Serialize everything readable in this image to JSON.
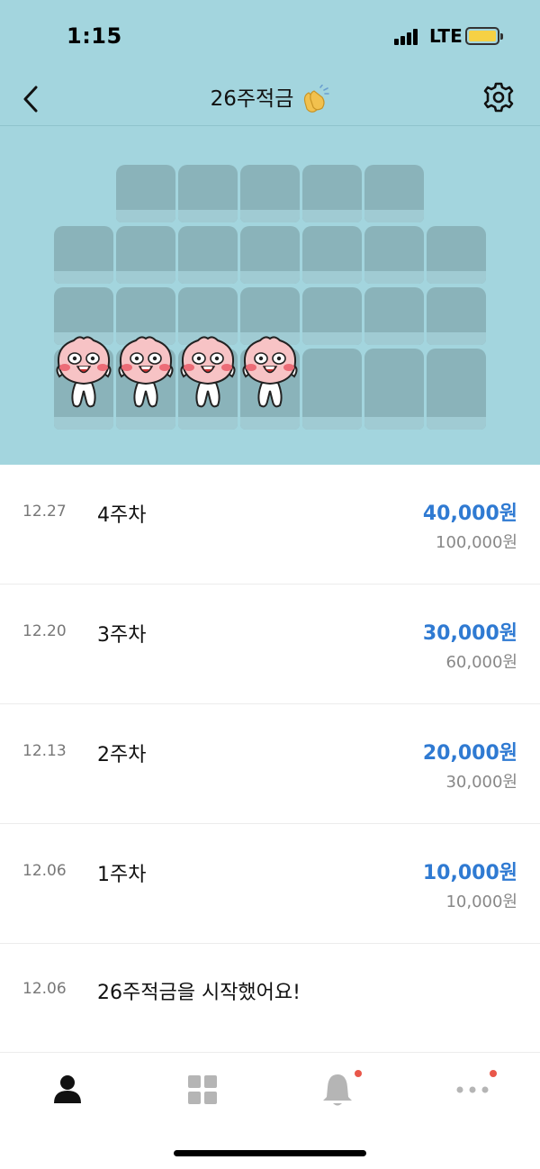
{
  "status_bar": {
    "time": "1:15",
    "network": "LTE"
  },
  "header": {
    "title": "26주적금"
  },
  "progress": {
    "filled_weeks": 4,
    "total_weeks": 26
  },
  "list": [
    {
      "date": "12.27",
      "label": "4주차",
      "amount": "40,000원",
      "total": "100,000원"
    },
    {
      "date": "12.20",
      "label": "3주차",
      "amount": "30,000원",
      "total": "60,000원"
    },
    {
      "date": "12.13",
      "label": "2주차",
      "amount": "20,000원",
      "total": "30,000원"
    },
    {
      "date": "12.06",
      "label": "1주차",
      "amount": "10,000원",
      "total": "10,000원"
    }
  ],
  "start_event": {
    "date": "12.06",
    "label": "26주적금을 시작했어요!"
  },
  "tabs": [
    {
      "icon": "person-icon",
      "active": true
    },
    {
      "icon": "grid-icon",
      "active": false
    },
    {
      "icon": "bell-icon",
      "active": false,
      "badge": true
    },
    {
      "icon": "more-icon",
      "active": false,
      "badge": true
    }
  ],
  "colors": {
    "accent": "#2f7ad2",
    "header_bg": "#a3d5de",
    "badge": "#e9574a"
  }
}
